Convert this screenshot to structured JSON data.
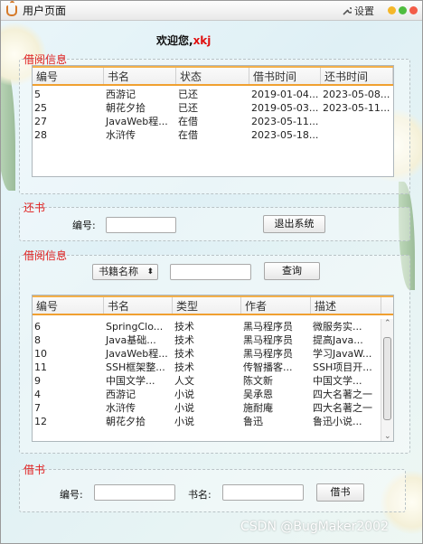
{
  "window": {
    "title": "用户页面",
    "settings_label": "设置"
  },
  "welcome": {
    "prefix": "欢迎您,",
    "username": "xkj"
  },
  "borrow_info": {
    "legend": "借阅信息",
    "columns": [
      "编号",
      "书名",
      "状态",
      "借书时间",
      "还书时间"
    ],
    "rows": [
      [
        "5",
        "西游记",
        "已还",
        "2019-01-04...",
        "2023-05-08..."
      ],
      [
        "25",
        "朝花夕拾",
        "已还",
        "2019-05-03...",
        "2023-05-11..."
      ],
      [
        "27",
        "JavaWeb程...",
        "在借",
        "2023-05-11...",
        ""
      ],
      [
        "28",
        "水浒传",
        "在借",
        "2023-05-18...",
        ""
      ]
    ]
  },
  "return_book": {
    "legend": "还书",
    "id_label": "编号:",
    "id_value": "",
    "exit_label": "退出系统"
  },
  "search": {
    "legend": "借阅信息",
    "field_selected": "书籍名称",
    "query": "",
    "search_label": "查询",
    "columns": [
      "编号",
      "书名",
      "类型",
      "作者",
      "描述"
    ],
    "rows": [
      [
        "6",
        "SpringClo...",
        "技术",
        "黑马程序员",
        "微服务实..."
      ],
      [
        "8",
        "Java基础...",
        "技术",
        "黑马程序员",
        "提高Java..."
      ],
      [
        "10",
        "JavaWeb程...",
        "技术",
        "黑马程序员",
        "学习JavaW..."
      ],
      [
        "11",
        "SSH框架整...",
        "技术",
        "传智播客...",
        "SSH项目开..."
      ],
      [
        "9",
        "中国文学...",
        "人文",
        "陈文新",
        "中国文学..."
      ],
      [
        "4",
        "西游记",
        "小说",
        "吴承恩",
        "四大名著之一"
      ],
      [
        "7",
        "水浒传",
        "小说",
        "施耐庵",
        "四大名著之一"
      ],
      [
        "12",
        "朝花夕拾",
        "小说",
        "鲁迅",
        "鲁迅小说..."
      ]
    ],
    "scroll_position": 0.25
  },
  "borrow_book": {
    "legend": "借书",
    "id_label": "编号:",
    "id_value": "",
    "name_label": "书名:",
    "name_value": "",
    "borrow_label": "借书"
  },
  "watermark": "CSDN @BugMaker2002",
  "colors": {
    "legend": "#e02020",
    "accent": "#f0a030",
    "username": "#e01010"
  }
}
